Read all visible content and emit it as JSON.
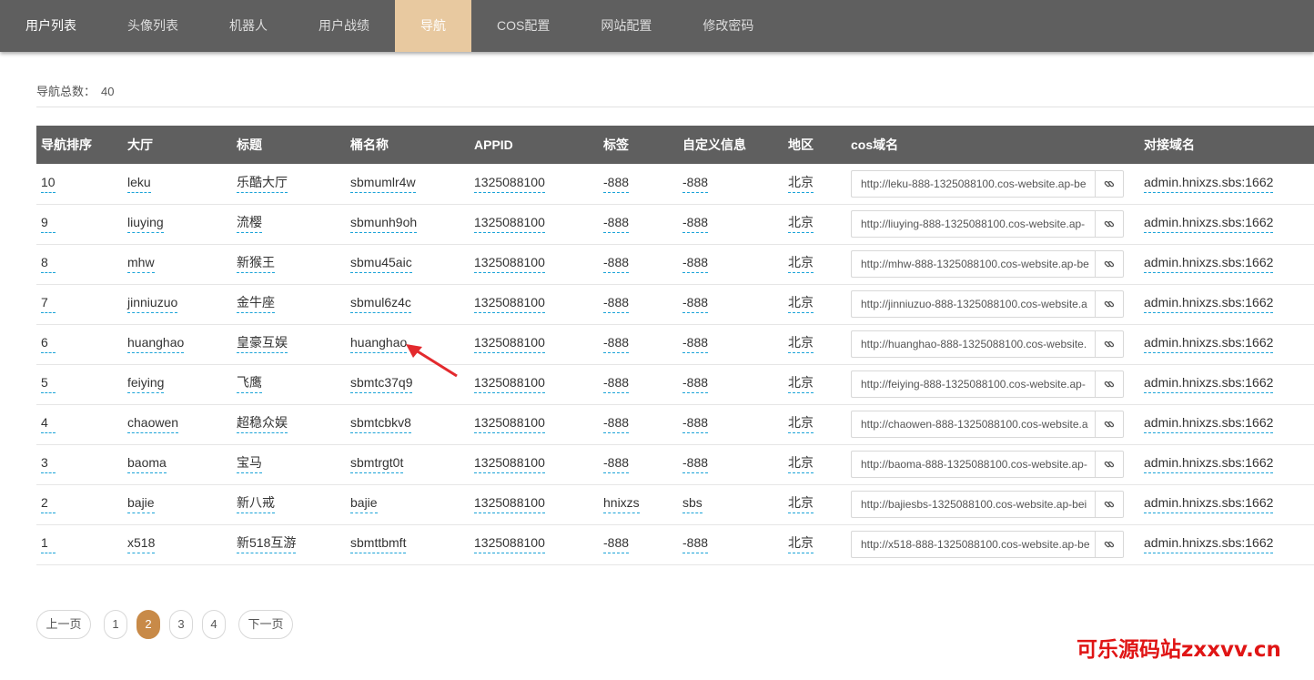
{
  "nav": {
    "tabs": [
      {
        "label": "用户列表"
      },
      {
        "label": "头像列表"
      },
      {
        "label": "机器人"
      },
      {
        "label": "用户战绩"
      },
      {
        "label": "导航"
      },
      {
        "label": "COS配置"
      },
      {
        "label": "网站配置"
      },
      {
        "label": "修改密码"
      }
    ],
    "active_index": 4
  },
  "summary": {
    "label": "导航总数：",
    "count": "40"
  },
  "table": {
    "headers": [
      "导航排序",
      "大厅",
      "标题",
      "桶名称",
      "APPID",
      "标签",
      "自定义信息",
      "地区",
      "cos域名",
      "对接域名"
    ],
    "rows": [
      {
        "order": "10",
        "hall": "leku",
        "title": "乐酷大厅",
        "bucket": "sbmumlr4w",
        "appid": "1325088100",
        "tag": "-888",
        "custom": "-888",
        "region": "北京",
        "cos_domain": "http://leku-888-1325088100.cos-website.ap-be",
        "target_domain": "admin.hnixzs.sbs:1662"
      },
      {
        "order": "9",
        "hall": "liuying",
        "title": "流樱",
        "bucket": "sbmunh9oh",
        "appid": "1325088100",
        "tag": "-888",
        "custom": "-888",
        "region": "北京",
        "cos_domain": "http://liuying-888-1325088100.cos-website.ap-",
        "target_domain": "admin.hnixzs.sbs:1662"
      },
      {
        "order": "8",
        "hall": "mhw",
        "title": "新猴王",
        "bucket": "sbmu45aic",
        "appid": "1325088100",
        "tag": "-888",
        "custom": "-888",
        "region": "北京",
        "cos_domain": "http://mhw-888-1325088100.cos-website.ap-be",
        "target_domain": "admin.hnixzs.sbs:1662"
      },
      {
        "order": "7",
        "hall": "jinniuzuo",
        "title": "金牛座",
        "bucket": "sbmul6z4c",
        "appid": "1325088100",
        "tag": "-888",
        "custom": "-888",
        "region": "北京",
        "cos_domain": "http://jinniuzuo-888-1325088100.cos-website.a",
        "target_domain": "admin.hnixzs.sbs:1662"
      },
      {
        "order": "6",
        "hall": "huanghao",
        "title": "皇豪互娱",
        "bucket": "huanghao",
        "appid": "1325088100",
        "tag": "-888",
        "custom": "-888",
        "region": "北京",
        "cos_domain": "http://huanghao-888-1325088100.cos-website.",
        "target_domain": "admin.hnixzs.sbs:1662"
      },
      {
        "order": "5",
        "hall": "feiying",
        "title": "飞鹰",
        "bucket": "sbmtc37q9",
        "appid": "1325088100",
        "tag": "-888",
        "custom": "-888",
        "region": "北京",
        "cos_domain": "http://feiying-888-1325088100.cos-website.ap-",
        "target_domain": "admin.hnixzs.sbs:1662"
      },
      {
        "order": "4",
        "hall": "chaowen",
        "title": "超稳众娱",
        "bucket": "sbmtcbkv8",
        "appid": "1325088100",
        "tag": "-888",
        "custom": "-888",
        "region": "北京",
        "cos_domain": "http://chaowen-888-1325088100.cos-website.a",
        "target_domain": "admin.hnixzs.sbs:1662"
      },
      {
        "order": "3",
        "hall": "baoma",
        "title": "宝马",
        "bucket": "sbmtrgt0t",
        "appid": "1325088100",
        "tag": "-888",
        "custom": "-888",
        "region": "北京",
        "cos_domain": "http://baoma-888-1325088100.cos-website.ap-",
        "target_domain": "admin.hnixzs.sbs:1662"
      },
      {
        "order": "2",
        "hall": "bajie",
        "title": "新八戒",
        "bucket": "bajie",
        "appid": "1325088100",
        "tag": "hnixzs",
        "custom": "sbs",
        "region": "北京",
        "cos_domain": "http://bajiesbs-1325088100.cos-website.ap-bei",
        "target_domain": "admin.hnixzs.sbs:1662"
      },
      {
        "order": "1",
        "hall": "x518",
        "title": "新518互游",
        "bucket": "sbmttbmft",
        "appid": "1325088100",
        "tag": "-888",
        "custom": "-888",
        "region": "北京",
        "cos_domain": "http://x518-888-1325088100.cos-website.ap-be",
        "target_domain": "admin.hnixzs.sbs:1662"
      }
    ]
  },
  "pager": {
    "prev": "上一页",
    "next": "下一页",
    "pages": [
      "1",
      "2",
      "3",
      "4"
    ],
    "current": "2"
  },
  "watermark": "可乐源码站zxxvv.cn",
  "icons": {
    "copy": "link-icon",
    "annotation": "red-arrow"
  },
  "colors": {
    "nav_bg": "#5f5f5f",
    "active_tab": "#e8c9a0",
    "pager_current": "#c88a48",
    "dashed_underline": "#1aa3d8",
    "watermark": "#e01515"
  }
}
